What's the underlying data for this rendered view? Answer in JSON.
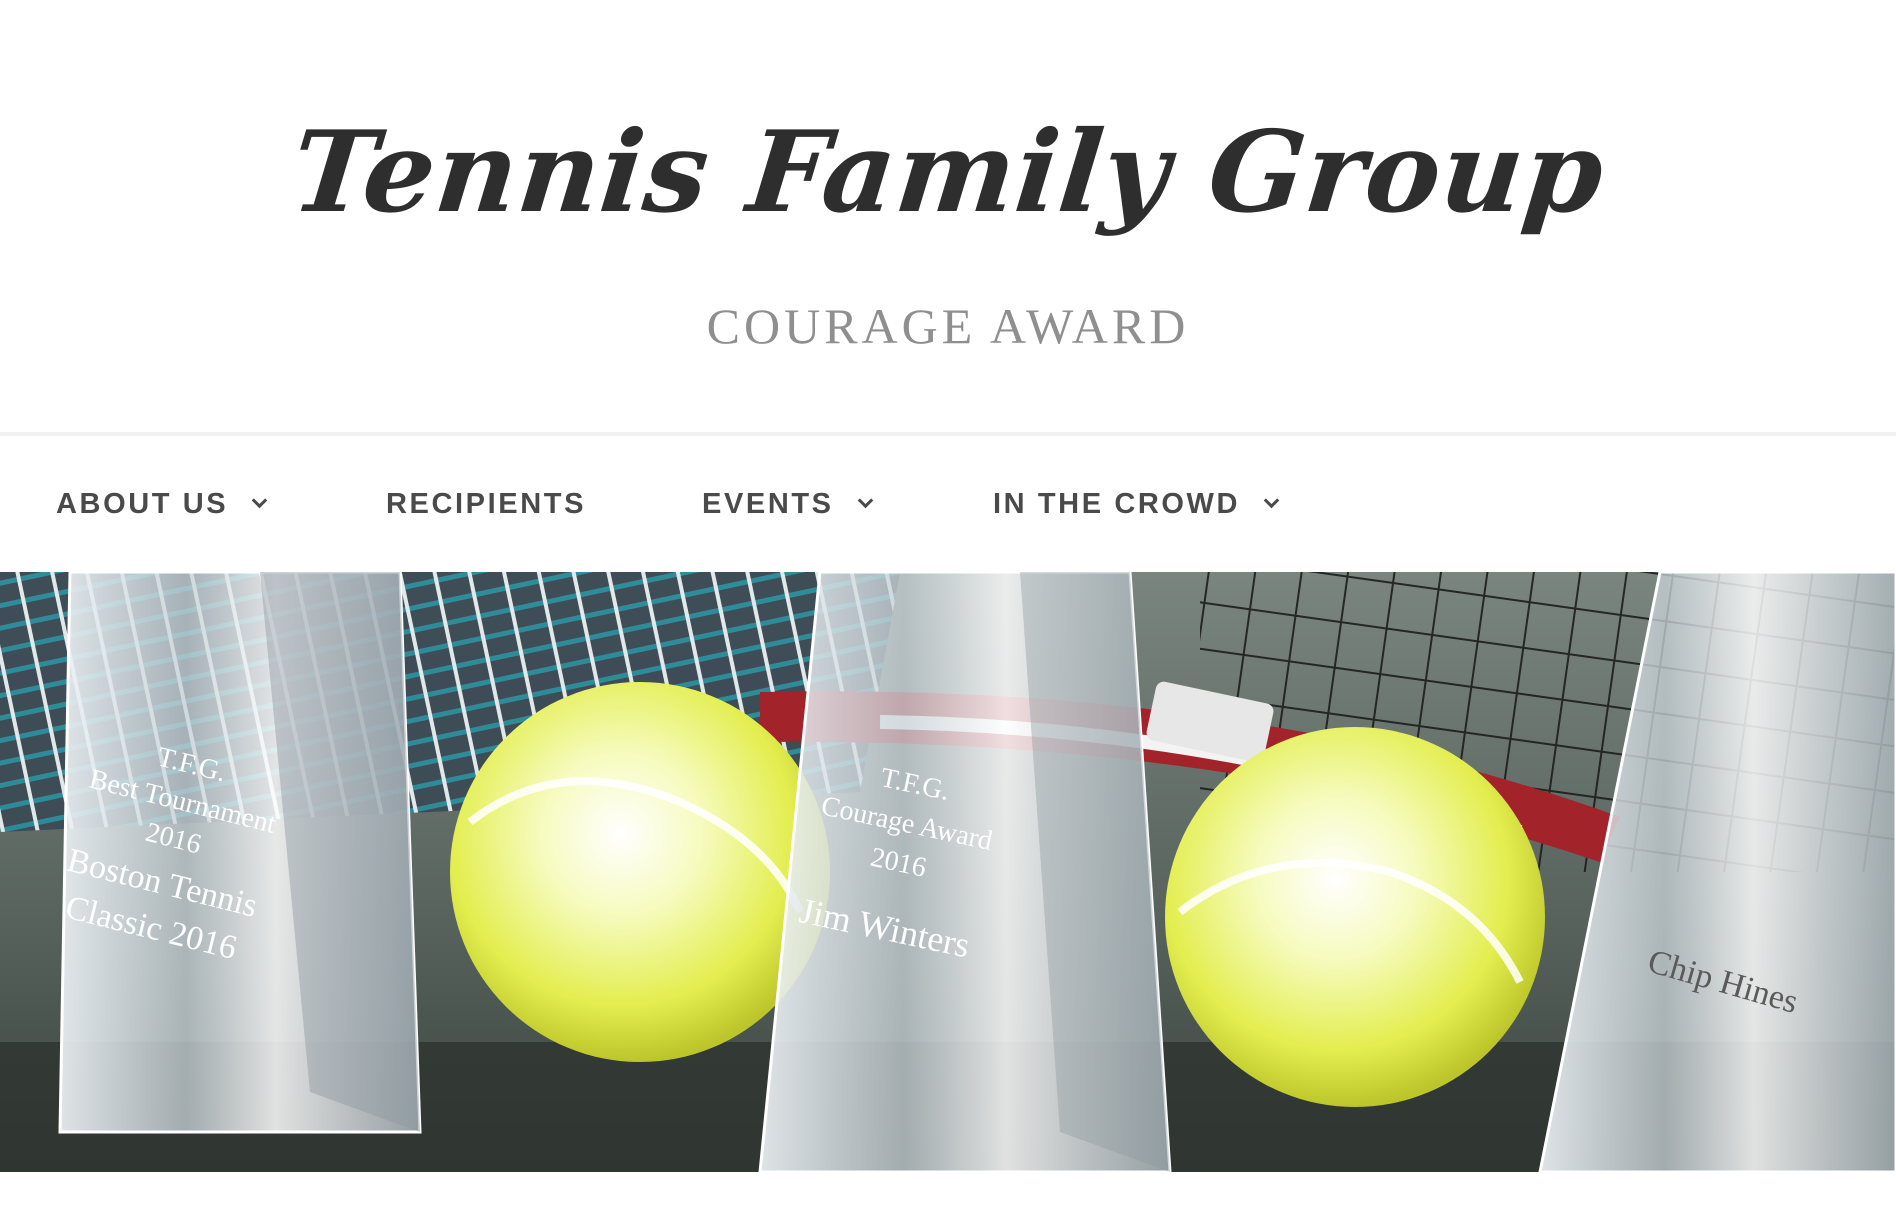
{
  "site": {
    "title": "Tennis Family Group",
    "tagline": "COURAGE AWARD"
  },
  "nav": {
    "items": [
      {
        "label": "ABOUT US",
        "has_dropdown": true,
        "icon": "chevron-down-icon"
      },
      {
        "label": "RECIPIENTS",
        "has_dropdown": false
      },
      {
        "label": "EVENTS",
        "has_dropdown": true,
        "icon": "chevron-down-icon"
      },
      {
        "label": "IN THE CROWD",
        "has_dropdown": true,
        "icon": "chevron-down-icon"
      }
    ]
  },
  "hero": {
    "trophies": [
      {
        "lines": [
          "T.F.G.",
          "Best Tournament",
          "2016",
          "Boston Tennis",
          "Classic 2016"
        ]
      },
      {
        "lines": [
          "T.F.G.",
          "Courage Award",
          "2016",
          "Jim Winters"
        ]
      },
      {
        "lines": [
          "Chip Hines"
        ]
      }
    ]
  },
  "colors": {
    "title": "#2e2e2e",
    "tagline": "#8f8f8f",
    "nav_text": "#4a4a4a",
    "ball": "#e6f05a",
    "racket_red": "#a3232b",
    "strings": "#2b8c9a"
  }
}
